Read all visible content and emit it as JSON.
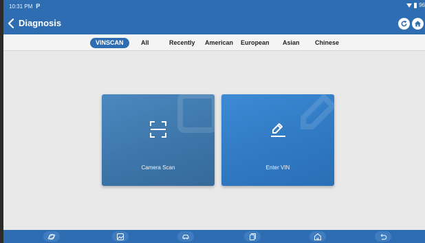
{
  "status_bar": {
    "time": "10:31 PM",
    "battery": "96"
  },
  "header": {
    "title": "Diagnosis",
    "icons": [
      "back-chevron-icon",
      "refresh-icon",
      "home-icon"
    ]
  },
  "tabs": [
    {
      "label": "VINSCAN",
      "active": true
    },
    {
      "label": "All",
      "active": false
    },
    {
      "label": "Recently",
      "active": false
    },
    {
      "label": "American",
      "active": false
    },
    {
      "label": "European",
      "active": false
    },
    {
      "label": "Asian",
      "active": false
    },
    {
      "label": "Chinese",
      "active": false
    }
  ],
  "cards": {
    "camera_scan": {
      "label": "Camera Scan",
      "icon": "scan-frame-icon"
    },
    "enter_vin": {
      "label": "Enter VIN",
      "icon": "pencil-edit-icon"
    }
  },
  "bottom_nav": {
    "icons": [
      "planet-icon",
      "image-icon",
      "car-icon",
      "recent-apps-icon",
      "home-icon",
      "back-icon"
    ]
  },
  "colors": {
    "primary": "#2e6db1",
    "background": "#e9e9e9",
    "card_scan": "#3c75a8",
    "card_vin": "#2f78c2"
  }
}
